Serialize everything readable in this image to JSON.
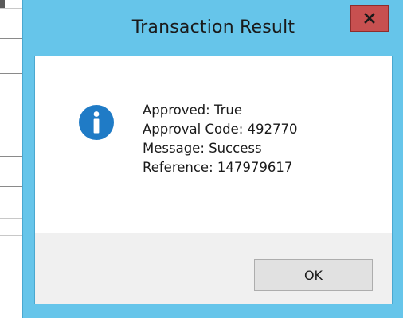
{
  "dialog": {
    "title": "Transaction Result",
    "close_icon": "close-icon",
    "info_icon": "info-icon",
    "lines": [
      "Approved: True",
      "Approval Code: 492770",
      "Message: Success",
      "Reference: 147979617"
    ],
    "ok_label": "OK"
  },
  "colors": {
    "title_bar": "#66c5ea",
    "close_button": "#c75050",
    "info_icon": "#1f7bc6",
    "button_area": "#f0f0f0"
  }
}
